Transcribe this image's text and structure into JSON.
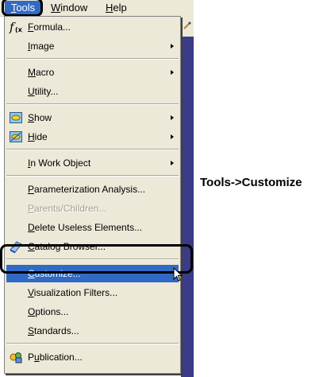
{
  "menubar": {
    "items": [
      {
        "label": "Tools",
        "mnemonic": "T"
      },
      {
        "label": "Window",
        "mnemonic": "W"
      },
      {
        "label": "Help",
        "mnemonic": "H"
      }
    ]
  },
  "menu": {
    "items": [
      {
        "label": "Formula...",
        "mnemonic": "F",
        "icon": "formula-fx-icon",
        "submenu": false
      },
      {
        "label": "Image",
        "mnemonic": "I",
        "submenu": true
      },
      {
        "label": "Macro",
        "mnemonic": "M",
        "submenu": true
      },
      {
        "label": "Utility...",
        "mnemonic": "U",
        "submenu": false
      },
      {
        "label": "Show",
        "mnemonic": "S",
        "icon": "show-icon",
        "submenu": true
      },
      {
        "label": "Hide",
        "mnemonic": "H",
        "icon": "hide-icon",
        "submenu": true
      },
      {
        "label": "In Work Object",
        "mnemonic": "I",
        "submenu": true
      },
      {
        "label": "Parameterization Analysis...",
        "mnemonic": "P",
        "submenu": false
      },
      {
        "label": "Parents/Children...",
        "mnemonic": "P",
        "submenu": false,
        "disabled": true
      },
      {
        "label": "Delete Useless Elements...",
        "mnemonic": "D",
        "submenu": false
      },
      {
        "label": "Catalog Browser...",
        "mnemonic": "C",
        "icon": "catalog-book-icon",
        "submenu": false
      },
      {
        "label": "Customize...",
        "mnemonic": "C",
        "submenu": false,
        "selected": true
      },
      {
        "label": "Visualization Filters...",
        "mnemonic": "V",
        "submenu": false
      },
      {
        "label": "Options...",
        "mnemonic": "O",
        "submenu": false
      },
      {
        "label": "Standards...",
        "mnemonic": "S",
        "submenu": false
      },
      {
        "label": "Publication...",
        "mnemonic": "u",
        "icon": "publication-icon",
        "submenu": false
      }
    ]
  },
  "annotation": {
    "text": "Tools->Customize"
  },
  "colors": {
    "menu_bg": "#ece9d8",
    "highlight": "#316ac5",
    "canvas": "#3b3b87",
    "disabled_text": "#a19f96"
  }
}
